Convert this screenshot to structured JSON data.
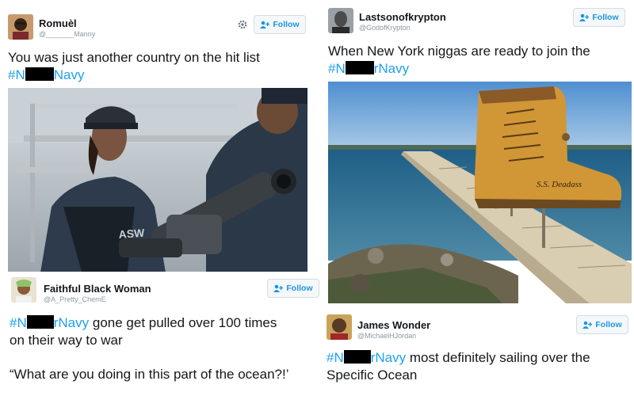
{
  "tweet_top_left": {
    "name": "Romuèl",
    "handle": "@_______Manny",
    "follow_label": "Follow",
    "line1": "You was just another country on the hit list",
    "hashtag_prefix": "#N",
    "hashtag_suffix": "Navy",
    "image_desc_icon": "military-photo"
  },
  "tweet_top_right": {
    "name": "Lastsonofkrypton",
    "handle": "@GodofKrypton",
    "follow_label": "Follow",
    "line1": "When New York niggas are ready to join the",
    "hashtag_prefix": "#N",
    "hashtag_suffix": "rNavy",
    "boot_label": "S.S. Deadass"
  },
  "tweet_bottom_left": {
    "name": "Faithful Black Woman",
    "handle": "@A_Pretty_ChemE",
    "follow_label": "Follow",
    "hashtag_prefix": "#N",
    "hashtag_suffix": "rNavy",
    "line1_rest": " gone get pulled over 100 times",
    "line2": "on their way to war",
    "line3": "“What are you doing in this part of the ocean?!’"
  },
  "tweet_bottom_right": {
    "name": "James Wonder",
    "handle": "@MichaelHJordan",
    "follow_label": "Follow",
    "hashtag_prefix": "#N",
    "hashtag_suffix": "rNavy",
    "line1_rest": " most definitely sailing over the",
    "line2": "Specific Ocean"
  },
  "colors": {
    "accent": "#1da1f2",
    "follow_text": "#1b95e0",
    "handle": "#8899a6",
    "redact": "#000000"
  }
}
